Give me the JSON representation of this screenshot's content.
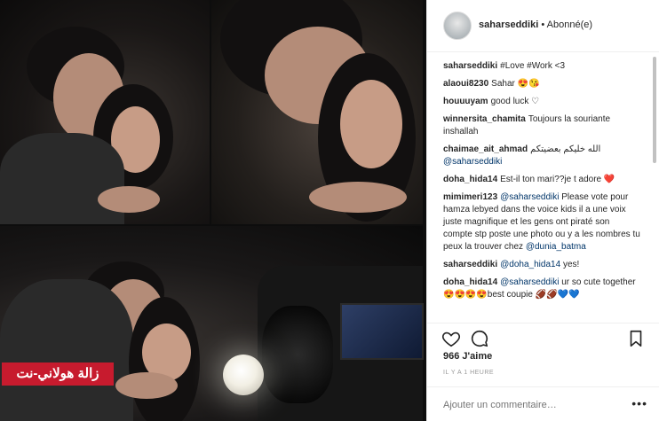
{
  "post": {
    "username": "saharseddiki",
    "follow_status": "Abonné(e)",
    "watermark": "زالة هولاني-نت"
  },
  "comments": [
    {
      "user": "saharseddiki",
      "text": "#Love #Work <3"
    },
    {
      "user": "alaoui8230",
      "text": "Sahar 😍😘"
    },
    {
      "user": "houuuyam",
      "text": "good luck ♡"
    },
    {
      "user": "winnersita_chamita",
      "text": "Toujours la souriante inshallah"
    },
    {
      "user": "chaimae_ait_ahmad",
      "text": "الله خليكم بعضيتكم",
      "mention": "@saharseddiki"
    },
    {
      "user": "doha_hida14",
      "text": "Est-il ton mari??je t adore ❤️"
    },
    {
      "user": "mimimeri123",
      "mention": "@saharseddiki",
      "text": "Please vote pour hamza lebyed dans the voice kids il a une voix juste magnifique et les gens ont piraté son compte stp poste une photo ou y a les nombres tu peux la trouver chez",
      "mention2": "@dunia_batma"
    },
    {
      "user": "saharseddiki",
      "mention": "@doha_hida14",
      "text": "yes!"
    },
    {
      "user": "doha_hida14",
      "mention": "@saharseddiki",
      "text": "ur so cute together 😍😍😍😍best coupie 🏈🏈💙💙"
    }
  ],
  "actions": {
    "like_icon": "heart-icon",
    "comment_icon": "comment-bubble-icon",
    "save_icon": "bookmark-icon"
  },
  "likes": "966 J'aime",
  "timestamp": "IL Y A 1 HEURE",
  "add_comment": {
    "placeholder": "Ajouter un commentaire…",
    "more": "•••"
  }
}
